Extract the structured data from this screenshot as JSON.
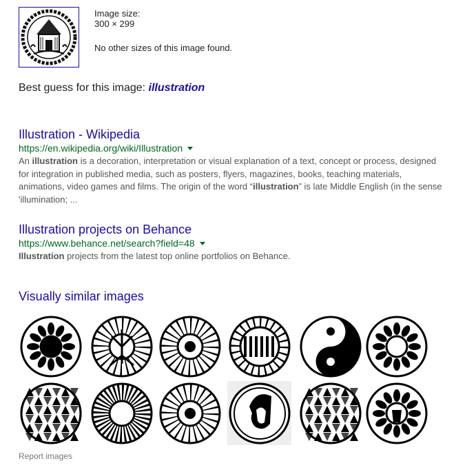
{
  "image_info": {
    "size_label": "Image size:",
    "size_value": "300 × 299",
    "no_other_sizes": "No other sizes of this image found."
  },
  "best_guess": {
    "prefix": "Best guess for this image: ",
    "term": "illustration"
  },
  "results": [
    {
      "title": "Illustration - Wikipedia",
      "url": "https://en.wikipedia.org/wiki/Illustration",
      "snippet": [
        {
          "t": "An "
        },
        {
          "t": "illustration",
          "b": true
        },
        {
          "t": " is a decoration, interpretation or visual explanation of a text, concept or process, designed for integration in published media, such as posters, flyers, magazines, books, teaching materials, animations, video games and films. The origin of the word “"
        },
        {
          "t": "illustration",
          "b": true
        },
        {
          "t": "” is late Middle English (in the sense 'illumination; ..."
        }
      ]
    },
    {
      "title": "Illustration projects on Behance",
      "url": "https://www.behance.net/search?field=48",
      "snippet": [
        {
          "t": "Illustration",
          "b": true
        },
        {
          "t": " projects from the latest top online portfolios on Behance."
        }
      ]
    }
  ],
  "similar": {
    "title": "Visually similar images",
    "images": [
      {
        "name": "similar-image-1",
        "style": "figure"
      },
      {
        "name": "similar-image-2",
        "style": "tree"
      },
      {
        "name": "similar-image-3",
        "style": "mandala"
      },
      {
        "name": "similar-image-4",
        "style": "bars"
      },
      {
        "name": "similar-image-5",
        "style": "yinyang"
      },
      {
        "name": "similar-image-6",
        "style": "ornate"
      },
      {
        "name": "similar-image-7",
        "style": "tessellation"
      },
      {
        "name": "similar-image-8",
        "style": "spiral"
      },
      {
        "name": "similar-image-9",
        "style": "mandala2"
      },
      {
        "name": "similar-image-10",
        "style": "portrait"
      },
      {
        "name": "similar-image-11",
        "style": "tessellation"
      },
      {
        "name": "similar-image-12",
        "style": "warrior"
      }
    ]
  },
  "report_link": "Report images",
  "colors": {
    "link": "#1a0dab",
    "url_green": "#006621",
    "snippet_gray": "#545454",
    "report_gray": "#777777"
  }
}
